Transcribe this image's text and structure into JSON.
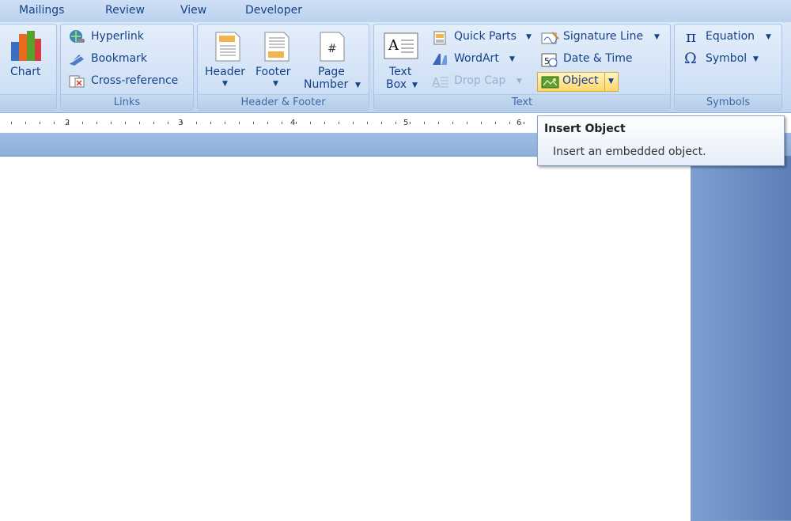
{
  "tabs": [
    "Mailings",
    "Review",
    "View",
    "Developer"
  ],
  "groups": {
    "illustrations": {
      "chart_label": "Chart"
    },
    "links": {
      "label": "Links",
      "items": [
        "Hyperlink",
        "Bookmark",
        "Cross-reference"
      ]
    },
    "header_footer": {
      "label": "Header & Footer",
      "header": "Header",
      "footer": "Footer",
      "page_number_1": "Page",
      "page_number_2": "Number"
    },
    "text": {
      "label": "Text",
      "text_box_1": "Text",
      "text_box_2": "Box",
      "quick_parts": "Quick Parts",
      "wordart": "WordArt",
      "drop_cap": "Drop Cap",
      "signature_line": "Signature Line",
      "date_time": "Date & Time",
      "object": "Object"
    },
    "symbols": {
      "label": "Symbols",
      "equation": "Equation",
      "symbol": "Symbol"
    }
  },
  "ruler": [
    "2",
    "3",
    "4",
    "5",
    "6"
  ],
  "tooltip": {
    "title": "Insert Object",
    "body": "Insert an embedded object."
  },
  "icons": [
    "chart-icon",
    "hyperlink-icon",
    "bookmark-icon",
    "cross-reference-icon",
    "header-icon",
    "footer-icon",
    "page-number-icon",
    "text-box-icon",
    "quick-parts-icon",
    "wordart-icon",
    "drop-cap-icon",
    "signature-line-icon",
    "date-time-icon",
    "object-icon",
    "pi-icon",
    "omega-icon"
  ]
}
